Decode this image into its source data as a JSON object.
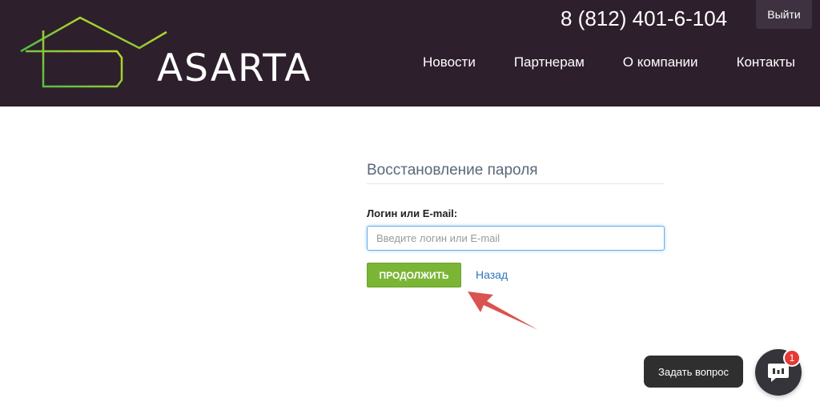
{
  "header": {
    "brand": "ASARTA",
    "phone": "8 (812) 401-6-104",
    "logout_label": "Выйти",
    "nav": [
      "Новости",
      "Партнерам",
      "О компании",
      "Контакты"
    ]
  },
  "form": {
    "title": "Восстановление пароля",
    "login_label": "Логин или E-mail:",
    "login_placeholder": "Введите логин или E-mail",
    "login_value": "",
    "submit_label": "ПРОДОЛЖИТЬ",
    "back_label": "Назад"
  },
  "chat": {
    "ask_label": "Задать вопрос",
    "badge_count": "1"
  },
  "colors": {
    "header_bg": "#2e1f2c",
    "accent_green": "#7ab535",
    "link_blue": "#2f78b7",
    "arrow_red": "#d9534f"
  },
  "icons": [
    "asarta-house-logo-icon",
    "chat-icon",
    "red-arrow-annotation"
  ]
}
